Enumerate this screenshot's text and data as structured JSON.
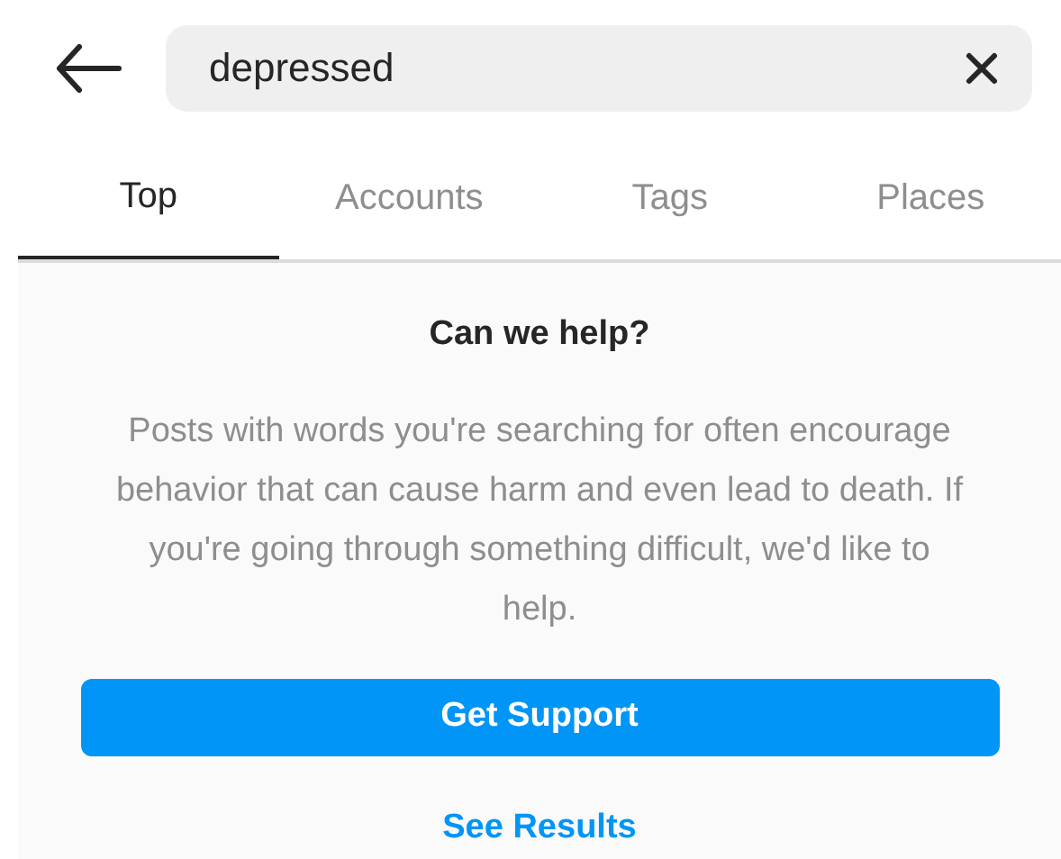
{
  "search": {
    "value": "depressed"
  },
  "tabs": [
    {
      "label": "Top",
      "selected": true
    },
    {
      "label": "Accounts",
      "selected": false
    },
    {
      "label": "Tags",
      "selected": false
    },
    {
      "label": "Places",
      "selected": false
    }
  ],
  "notice": {
    "title": "Can we help?",
    "body": "Posts with words you're searching for often encourage behavior that can cause harm and even lead to death. If you're going through something difficult, we'd like to help.",
    "primary_button": "Get Support",
    "secondary_link": "See Results"
  }
}
